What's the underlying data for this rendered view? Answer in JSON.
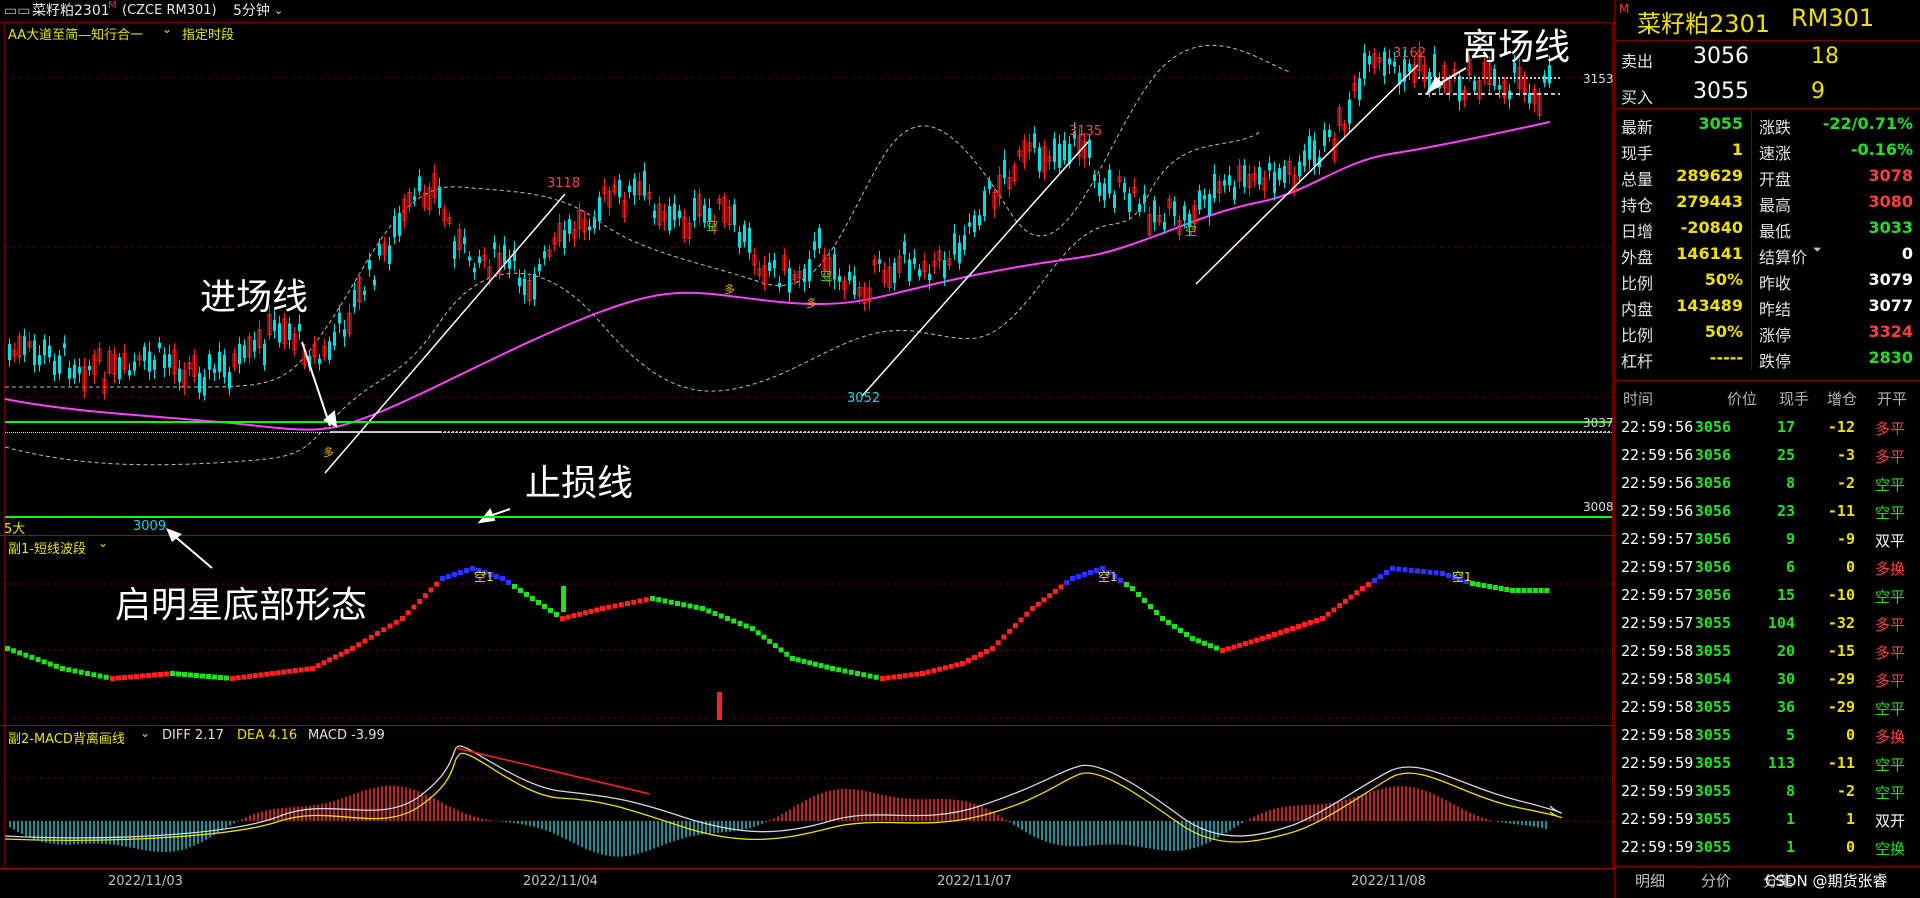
{
  "header": {
    "instrument": "菜籽粕2301",
    "mark": "M",
    "code": "(CZCE RM301)",
    "period": "5分钟",
    "indicator": "AA大道至简—知行合一",
    "period_mode": "指定时段"
  },
  "main_chart": {
    "right_labels": [
      "3153",
      "3037",
      "3008"
    ],
    "annotations": {
      "entry": "进场线",
      "exit": "离场线",
      "stop": "止损线",
      "morning_star": "启明星底部形态"
    },
    "price_marks": [
      "3118",
      "3135",
      "3162",
      "3052",
      "3009"
    ],
    "signal_labels": [
      "空",
      "空",
      "空",
      "多",
      "多",
      "多"
    ],
    "bottom_left_label": "5大"
  },
  "sub1": {
    "title": "副1-短线波段",
    "signal": "空1"
  },
  "sub2": {
    "title": "副2-MACD背离画线",
    "diff": "DIFF 2.17",
    "dea": "DEA 4.16",
    "macd": "MACD -3.99"
  },
  "dates": [
    "2022/11/03",
    "2022/11/04",
    "2022/11/07",
    "2022/11/08"
  ],
  "quote": {
    "name": "菜籽粕2301",
    "code": "RM301",
    "mark": "M",
    "sell": {
      "label": "卖出",
      "price": "3056",
      "vol": "18"
    },
    "buy": {
      "label": "买入",
      "price": "3055",
      "vol": "9"
    },
    "rows": [
      {
        "l1": "最新",
        "v1": "3055",
        "c1": "grn",
        "l2": "涨跌",
        "v2": "-22/0.71%",
        "c2": "grn"
      },
      {
        "l1": "现手",
        "v1": "1",
        "c1": "yel",
        "l2": "速涨",
        "v2": "-0.16%",
        "c2": "grn"
      },
      {
        "l1": "总量",
        "v1": "289629",
        "c1": "yel",
        "l2": "开盘",
        "v2": "3078",
        "c2": "red"
      },
      {
        "l1": "持仓",
        "v1": "279443",
        "c1": "yel",
        "l2": "最高",
        "v2": "3080",
        "c2": "red"
      },
      {
        "l1": "日增",
        "v1": "-20840",
        "c1": "yel",
        "l2": "最低",
        "v2": "3033",
        "c2": "grn"
      },
      {
        "l1": "外盘",
        "v1": "146141",
        "c1": "yel",
        "l2": "结算价",
        "v2": "0",
        "c2": "wht"
      },
      {
        "l1": "比例",
        "v1": "50%",
        "c1": "yel",
        "l2": "昨收",
        "v2": "3079",
        "c2": "wht"
      },
      {
        "l1": "内盘",
        "v1": "143489",
        "c1": "yel",
        "l2": "昨结",
        "v2": "3077",
        "c2": "wht"
      },
      {
        "l1": "比例",
        "v1": "50%",
        "c1": "yel",
        "l2": "涨停",
        "v2": "3324",
        "c2": "red"
      },
      {
        "l1": "杠杆",
        "v1": "-----",
        "c1": "yel",
        "l2": "跌停",
        "v2": "2830",
        "c2": "grn"
      }
    ]
  },
  "trades": {
    "headers": [
      "时间",
      "价位",
      "现手",
      "增仓",
      "开平"
    ],
    "rows": [
      [
        "22:59:56",
        "3056",
        "17",
        "-12",
        "多平"
      ],
      [
        "22:59:56",
        "3056",
        "25",
        "-3",
        "多平"
      ],
      [
        "22:59:56",
        "3056",
        "8",
        "-2",
        "空平"
      ],
      [
        "22:59:56",
        "3056",
        "23",
        "-11",
        "空平"
      ],
      [
        "22:59:57",
        "3056",
        "9",
        "-9",
        "双平"
      ],
      [
        "22:59:57",
        "3056",
        "6",
        "0",
        "多换"
      ],
      [
        "22:59:57",
        "3056",
        "15",
        "-10",
        "空平"
      ],
      [
        "22:59:57",
        "3055",
        "104",
        "-32",
        "多平"
      ],
      [
        "22:59:58",
        "3055",
        "20",
        "-15",
        "多平"
      ],
      [
        "22:59:58",
        "3054",
        "30",
        "-29",
        "多平"
      ],
      [
        "22:59:58",
        "3055",
        "36",
        "-29",
        "空平"
      ],
      [
        "22:59:58",
        "3055",
        "5",
        "0",
        "多换"
      ],
      [
        "22:59:59",
        "3055",
        "113",
        "-11",
        "空平"
      ],
      [
        "22:59:59",
        "3055",
        "8",
        "-2",
        "空平"
      ],
      [
        "22:59:59",
        "3055",
        "1",
        "1",
        "双开"
      ],
      [
        "22:59:59",
        "3055",
        "1",
        "0",
        "空换"
      ]
    ]
  },
  "tabs": [
    "明细",
    "分价",
    "分笔"
  ],
  "watermark": "CSDN @期货张睿",
  "colors": {
    "up": "#ff2020",
    "down": "#00e0e0",
    "ma": "#ff40ff",
    "stop": "#00ff00"
  }
}
